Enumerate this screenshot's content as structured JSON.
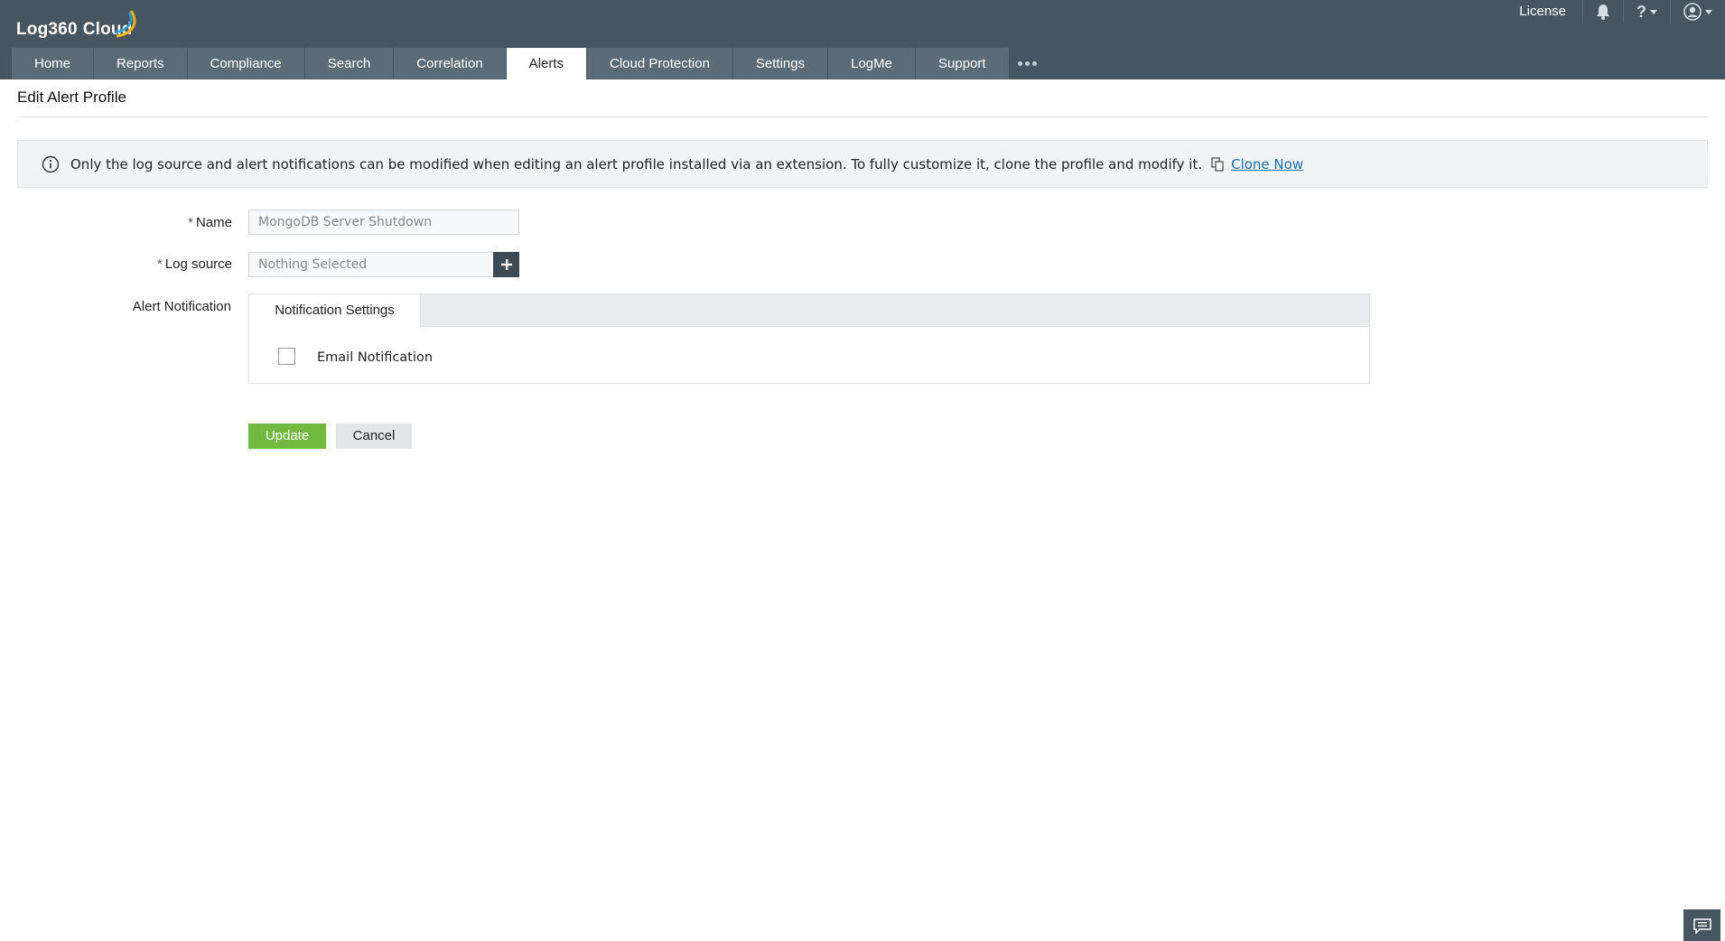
{
  "app": {
    "logo_text": "Log360",
    "logo_suffix": "Cloud"
  },
  "top_bar": {
    "license_label": "License",
    "icons": [
      "bell-icon",
      "help-icon",
      "user-icon"
    ]
  },
  "nav": {
    "tabs": [
      {
        "label": "Home"
      },
      {
        "label": "Reports"
      },
      {
        "label": "Compliance"
      },
      {
        "label": "Search"
      },
      {
        "label": "Correlation"
      },
      {
        "label": "Alerts",
        "active": true
      },
      {
        "label": "Cloud Protection"
      },
      {
        "label": "Settings"
      },
      {
        "label": "LogMe"
      },
      {
        "label": "Support"
      }
    ]
  },
  "page": {
    "title": "Edit Alert Profile"
  },
  "info_bar": {
    "message": "Only the log source and alert notifications can be modified when editing an alert profile installed via an extension. To fully customize it, clone the profile and modify it.",
    "link_label": "Clone Now"
  },
  "form": {
    "required_mark": "*",
    "name_label": "Name",
    "name_value": "MongoDB Server Shutdown",
    "log_source_label": "Log source",
    "log_source_value": "Nothing Selected",
    "alert_notification_label": "Alert Notification",
    "notification_tab_label": "Notification Settings",
    "email_notification_label": "Email Notification",
    "email_notification_checked": false
  },
  "buttons": {
    "update_label": "Update",
    "cancel_label": "Cancel"
  },
  "colors": {
    "header_bg": "#465560",
    "tab_bg": "#5b6b77",
    "update_button": "#72b93f",
    "link": "#1e6ea8"
  }
}
